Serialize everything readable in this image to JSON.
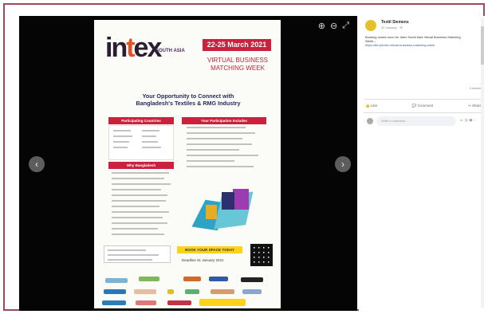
{
  "viewer": {
    "nav_left": "‹",
    "nav_right": "›",
    "tools": [
      "⊕",
      "⊖",
      "⤢"
    ],
    "poster": {
      "logo_main": "intex",
      "south_asia": "SOUTH ASIA",
      "date": "22-25 March 2021",
      "event_lines": [
        "VIRTUAL BUSINESS",
        "MATCHING WEEK"
      ],
      "headline": [
        "Your Opportunity to Connect with",
        "Bangladesh's Textiles & RMG Industry"
      ],
      "sections": [
        "Participating Countries",
        "Your Participation Includes",
        "Why Bangladesh"
      ],
      "book_space": "BOOK YOUR SPACE TODAY",
      "deadline": "Deadline 31 January 2021"
    }
  },
  "post": {
    "page_name": "Textil Siemens",
    "time": "30 January · ⊕",
    "description": "Booking closes soon for Intex South Asia Virtual Business Matching Week –",
    "link": "https://bit.ly/intex-virtual-business-matching-week",
    "shares": "3 shares",
    "actions": [
      "Like",
      "Comment",
      "Share"
    ],
    "comment_placeholder": "Write a comment...",
    "emoji_icons": "☺ ◎ ◉ ◌"
  }
}
